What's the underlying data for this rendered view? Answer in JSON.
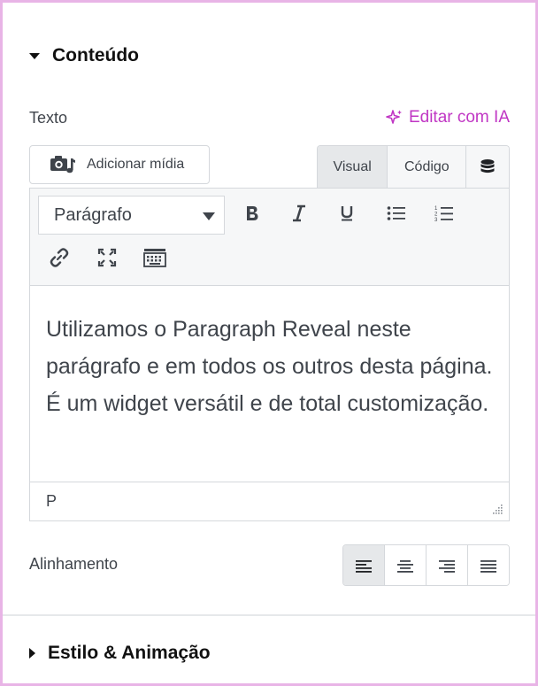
{
  "sections": {
    "content_title": "Conteúdo",
    "style_title": "Estilo & Animação"
  },
  "text_field": {
    "label": "Texto",
    "ai_edit_label": "Editar com IA",
    "add_media_label": "Adicionar mídia"
  },
  "editor": {
    "tabs": {
      "visual": "Visual",
      "code": "Código"
    },
    "format_select": "Parágrafo",
    "content": "Utilizamos o Paragraph Reveal neste parágrafo e em todos os outros desta página. É um widget versátil e de total customização.",
    "status_path": "P"
  },
  "alignment": {
    "label": "Alinhamento",
    "selected": "left"
  },
  "colors": {
    "accent": "#c036c4",
    "frame": "#e8b4e6"
  }
}
